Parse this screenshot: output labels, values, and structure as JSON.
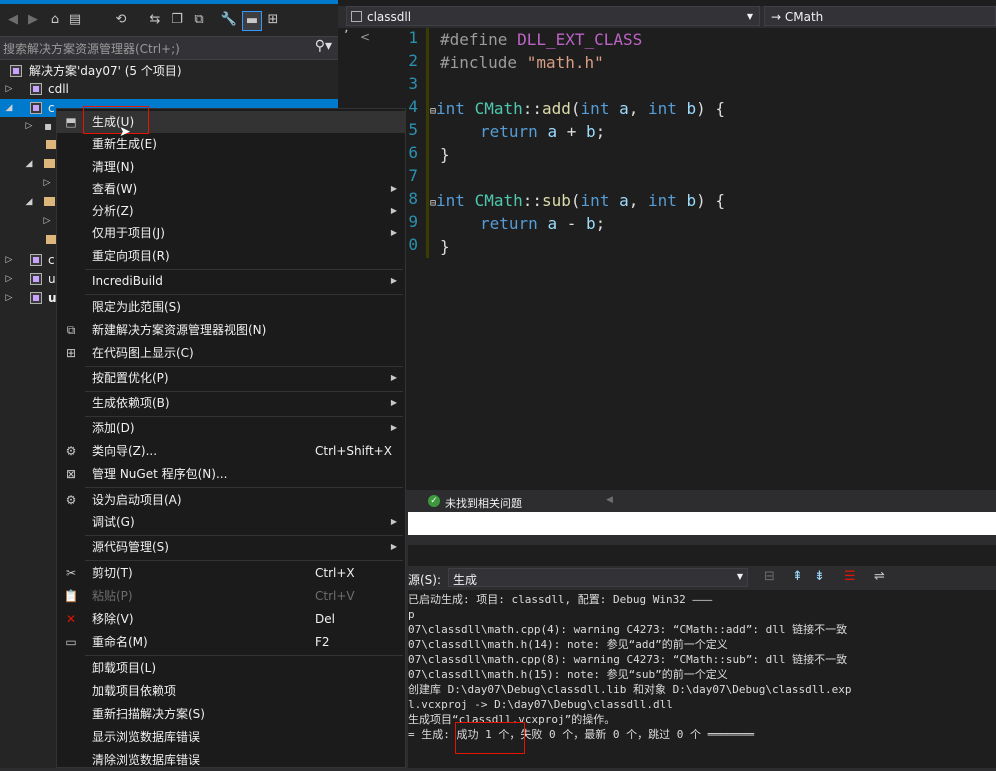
{
  "solution_explorer": {
    "search_placeholder": "搜索解决方案资源管理器(Ctrl+;)",
    "tree": [
      {
        "label": "解决方案'day07' (5 个项目)"
      },
      {
        "label": "cdll"
      },
      {
        "label": "c"
      },
      {
        "label": "c"
      },
      {
        "label": "u"
      },
      {
        "label": "u"
      }
    ]
  },
  "editor": {
    "file_combo": "classdll",
    "member_combo": "→ CMath",
    "lines": [
      "1",
      "2",
      "3",
      "4",
      "5",
      "6",
      "7",
      "8",
      "9",
      "0"
    ]
  },
  "context_menu": {
    "items": [
      {
        "label": "生成(U)"
      },
      {
        "label": "重新生成(E)"
      },
      {
        "label": "清理(N)"
      },
      {
        "label": "查看(W)"
      },
      {
        "label": "分析(Z)"
      },
      {
        "label": "仅用于项目(J)"
      },
      {
        "label": "重定向项目(R)"
      },
      {
        "label": "IncrediBuild"
      },
      {
        "label": "限定为此范围(S)"
      },
      {
        "label": "新建解决方案资源管理器视图(N)"
      },
      {
        "label": "在代码图上显示(C)"
      },
      {
        "label": "按配置优化(P)"
      },
      {
        "label": "生成依赖项(B)"
      },
      {
        "label": "添加(D)"
      },
      {
        "label": "类向导(Z)...",
        "shortcut": "Ctrl+Shift+X"
      },
      {
        "label": "管理 NuGet 程序包(N)..."
      },
      {
        "label": "设为启动项目(A)"
      },
      {
        "label": "调试(G)"
      },
      {
        "label": "源代码管理(S)"
      },
      {
        "label": "剪切(T)",
        "shortcut": "Ctrl+X"
      },
      {
        "label": "粘贴(P)",
        "shortcut": "Ctrl+V"
      },
      {
        "label": "移除(V)",
        "shortcut": "Del"
      },
      {
        "label": "重命名(M)",
        "shortcut": "F2"
      },
      {
        "label": "卸载项目(L)"
      },
      {
        "label": "加载项目依赖项"
      },
      {
        "label": "重新扫描解决方案(S)"
      },
      {
        "label": "显示浏览数据库错误"
      },
      {
        "label": "清除浏览数据库错误"
      }
    ]
  },
  "status": {
    "issues": "未找到相关问题"
  },
  "output": {
    "source_label": "源(S):",
    "source_value": "生成",
    "lines": [
      "已启动生成: 项目: classdll, 配置: Debug Win32 ———",
      "p",
      "07\\classdll\\math.cpp(4): warning C4273: “CMath::add”: dll 链接不一致",
      "07\\classdll\\math.h(14): note: 参见“add”的前一个定义",
      "07\\classdll\\math.cpp(8): warning C4273: “CMath::sub”: dll 链接不一致",
      "07\\classdll\\math.h(15): note: 参见“sub”的前一个定义",
      "创建库 D:\\day07\\Debug\\classdll.lib 和对象 D:\\day07\\Debug\\classdll.exp",
      "l.vcxproj -> D:\\day07\\Debug\\classdll.dll",
      "生成项目“classdll.vcxproj”的操作。",
      "= 生成: 成功 1 个，失败 0 个，最新 0 个，跳过 0 个 ═══════"
    ]
  },
  "colors": {
    "accent": "#007acc",
    "highlight_box": "#e51400"
  }
}
